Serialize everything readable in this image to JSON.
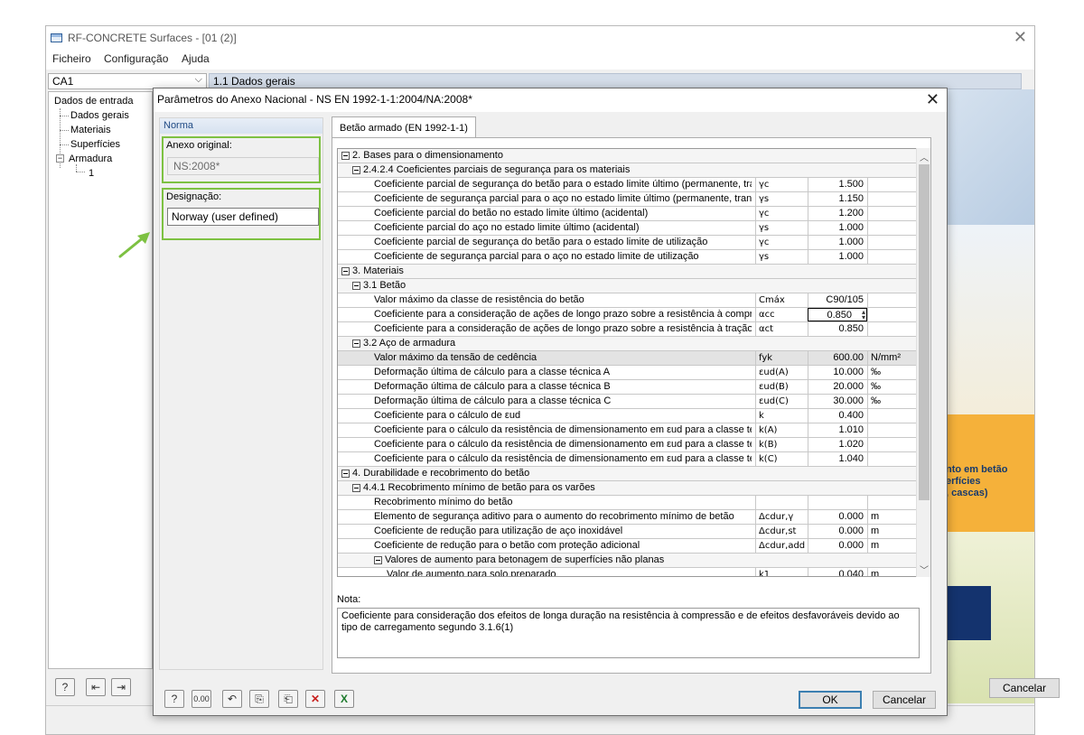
{
  "app": {
    "title": "RF-CONCRETE Surfaces - [01 (2)]",
    "menu": [
      "Ficheiro",
      "Configuração",
      "Ajuda"
    ],
    "case_combo": "CA1",
    "section_header": "1.1 Dados gerais",
    "nav_tree": {
      "root": "Dados de entrada",
      "items": [
        "Dados gerais",
        "Materiais",
        "Superfícies"
      ],
      "armadura": "Armadura",
      "armadura_child": "1"
    },
    "promo_text": [
      "nto em betão",
      "erfícies",
      ", cascas)"
    ],
    "cancel_label": "Cancelar"
  },
  "dialog": {
    "title": "Parâmetros do Anexo Nacional - NS EN 1992-1-1:2004/NA:2008*",
    "left_panel": {
      "header": "Norma",
      "original_label": "Anexo original:",
      "original_value": "NS:2008*",
      "designation_label": "Designação:",
      "designation_value": "Norway (user defined)"
    },
    "tab_label": "Betão armado (EN 1992-1-1)",
    "rows": [
      {
        "level": 0,
        "group": true,
        "desc": "2. Bases para o dimensionamento"
      },
      {
        "level": 1,
        "group": true,
        "desc": "2.4.2.4 Coeficientes parciais de segurança para os materiais"
      },
      {
        "level": 2,
        "desc": "Coeficiente parcial de segurança do betão para o estado limite último (permanente, transit",
        "sym": "γc",
        "val": "1.500",
        "unit": ""
      },
      {
        "level": 2,
        "desc": "Coeficiente de segurança parcial para o aço no estado limite último (permanente, transitó",
        "sym": "γs",
        "val": "1.150",
        "unit": ""
      },
      {
        "level": 2,
        "desc": "Coeficiente parcial do betão no estado limite último (acidental)",
        "sym": "γc",
        "val": "1.200",
        "unit": ""
      },
      {
        "level": 2,
        "desc": "Coeficiente parcial do aço no estado limite último (acidental)",
        "sym": "γs",
        "val": "1.000",
        "unit": ""
      },
      {
        "level": 2,
        "desc": "Coeficiente parcial de segurança do betão para o estado limite de utilização",
        "sym": "γc",
        "val": "1.000",
        "unit": ""
      },
      {
        "level": 2,
        "desc": "Coeficiente de segurança parcial para o aço no estado limite de utilização",
        "sym": "γs",
        "val": "1.000",
        "unit": ""
      },
      {
        "level": 0,
        "group": true,
        "desc": "3. Materiais"
      },
      {
        "level": 1,
        "group": true,
        "desc": "3.1 Betão"
      },
      {
        "level": 2,
        "desc": "Valor máximo da classe de resistência do betão",
        "sym": "Cmáx",
        "val": "C90/105",
        "unit": ""
      },
      {
        "level": 2,
        "desc": "Coeficiente para a consideração de ações de longo prazo sobre a resistência à compress",
        "sym": "αcc",
        "val": "0.850",
        "unit": "",
        "active": true
      },
      {
        "level": 2,
        "desc": "Coeficiente para a consideração de ações de longo prazo sobre a resistência à tração",
        "sym": "αct",
        "val": "0.850",
        "unit": ""
      },
      {
        "level": 1,
        "group": true,
        "desc": "3.2 Aço de armadura"
      },
      {
        "level": 2,
        "desc": "Valor máximo da tensão de cedência",
        "sym": "fyk",
        "val": "600.00",
        "unit": "N/mm²",
        "selected": true
      },
      {
        "level": 2,
        "desc": "Deformação última de cálculo para a classe técnica A",
        "sym": "εud(A)",
        "val": "10.000",
        "unit": "‰"
      },
      {
        "level": 2,
        "desc": "Deformação última de cálculo para a classe técnica B",
        "sym": "εud(B)",
        "val": "20.000",
        "unit": "‰"
      },
      {
        "level": 2,
        "desc": "Deformação última de cálculo para a classe técnica C",
        "sym": "εud(C)",
        "val": "30.000",
        "unit": "‰"
      },
      {
        "level": 2,
        "desc": "Coeficiente para o cálculo de εud",
        "sym": "k",
        "val": "0.400",
        "unit": ""
      },
      {
        "level": 2,
        "desc": "Coeficiente para o cálculo da resistência de dimensionamento em εud para a classe técni",
        "sym": "k(A)",
        "val": "1.010",
        "unit": ""
      },
      {
        "level": 2,
        "desc": "Coeficiente para o cálculo da resistência de dimensionamento em εud para a classe técni",
        "sym": "k(B)",
        "val": "1.020",
        "unit": ""
      },
      {
        "level": 2,
        "desc": "Coeficiente para o cálculo da resistência de dimensionamento em εud para a classe técni",
        "sym": "k(C)",
        "val": "1.040",
        "unit": ""
      },
      {
        "level": 0,
        "group": true,
        "desc": "4. Durabilidade e recobrimento do betão"
      },
      {
        "level": 1,
        "group": true,
        "desc": "4.4.1 Recobrimento mínimo de betão para os varões"
      },
      {
        "level": 2,
        "desc": "Recobrimento mínimo do betão",
        "sym": "",
        "val": "",
        "unit": ""
      },
      {
        "level": 2,
        "desc": "Elemento de segurança aditivo para o aumento do recobrimento mínimo de betão",
        "sym": "Δcdur,γ",
        "val": "0.000",
        "unit": "m"
      },
      {
        "level": 2,
        "desc": "Coeficiente de redução para utilização de aço inoxidável",
        "sym": "Δcdur,st",
        "val": "0.000",
        "unit": "m"
      },
      {
        "level": 2,
        "desc": "Coeficiente de redução para o betão com proteção adicional",
        "sym": "Δcdur,add",
        "val": "0.000",
        "unit": "m"
      },
      {
        "level": 2,
        "group": true,
        "desc": "Valores de aumento para betonagem de superfícies não planas"
      },
      {
        "level": 3,
        "desc": "Valor de aumento para solo preparado",
        "sym": "k1",
        "val": "0.040",
        "unit": "m"
      }
    ],
    "note_label": "Nota:",
    "note_text": "Coeficiente para consideração dos efeitos de longa duração na resistência à compressão e de efeitos desfavoráveis devido ao tipo de carregamento segundo 3.1.6(1)",
    "ok_label": "OK",
    "cancel_label": "Cancelar",
    "colors": {
      "highlight_green": "#7dc142",
      "selection_gray": "#e3e3e3"
    }
  }
}
